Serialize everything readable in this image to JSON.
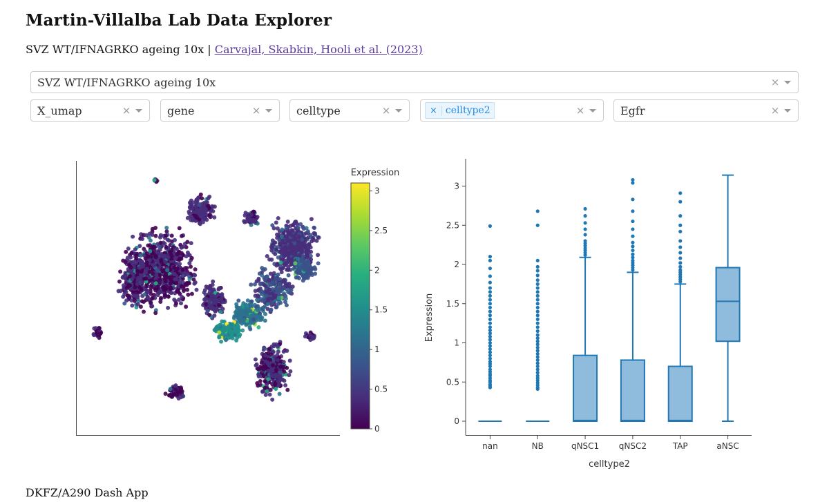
{
  "app": {
    "title": "Martin-Villalba Lab Data Explorer",
    "subtitle_prefix": "SVZ WT/IFNAGRKO ageing 10x | ",
    "subtitle_link": "Carvajal, Skabkin, Hooli et al. (2023)"
  },
  "controls": {
    "dataset": "SVZ WT/IFNAGRKO ageing 10x",
    "embedding": "X_umap",
    "color_by": "gene",
    "obs_field": "celltype",
    "selected_tag": "celltype2",
    "gene": "Egfr",
    "clear_glyph": "×",
    "tag_remove_glyph": "×"
  },
  "umap": {
    "colorbar_title": "Expression",
    "colorbar_ticks": [
      "0",
      "0.5",
      "1",
      "1.5",
      "2",
      "2.5",
      "3"
    ],
    "colorscale": [
      "#440154",
      "#472d7b",
      "#3b528b",
      "#2c728e",
      "#21918c",
      "#28ae80",
      "#5ec962",
      "#addc30",
      "#fde725"
    ]
  },
  "chart_data": {
    "type": "box",
    "xlabel": "celltype2",
    "ylabel": "Expression",
    "ylim": [
      0,
      3.2
    ],
    "yticks": [
      0,
      0.5,
      1,
      1.5,
      2,
      2.5,
      3
    ],
    "color": "#1f77b4",
    "fill": "#8fbbdc",
    "boxes": [
      {
        "category": "nan",
        "min": 0,
        "q1": 0,
        "median": 0,
        "q3": 0,
        "max": 0,
        "outliers": [
          0.43,
          0.45,
          0.47,
          0.5,
          0.52,
          0.55,
          0.58,
          0.6,
          0.63,
          0.66,
          0.7,
          0.73,
          0.76,
          0.8,
          0.84,
          0.88,
          0.92,
          0.96,
          1.0,
          1.04,
          1.08,
          1.12,
          1.16,
          1.2,
          1.25,
          1.3,
          1.35,
          1.4,
          1.45,
          1.5,
          1.55,
          1.6,
          1.65,
          1.7,
          1.77,
          1.85,
          1.95,
          2.05,
          2.1,
          2.49
        ]
      },
      {
        "category": "NB",
        "min": 0,
        "q1": 0,
        "median": 0,
        "q3": 0,
        "max": 0,
        "outliers": [
          0.41,
          0.43,
          0.46,
          0.49,
          0.52,
          0.55,
          0.58,
          0.62,
          0.66,
          0.7,
          0.74,
          0.78,
          0.82,
          0.86,
          0.9,
          0.94,
          0.98,
          1.02,
          1.06,
          1.1,
          1.15,
          1.2,
          1.25,
          1.3,
          1.35,
          1.4,
          1.45,
          1.5,
          1.55,
          1.6,
          1.65,
          1.7,
          1.75,
          1.8,
          1.86,
          1.92,
          1.97,
          2.05,
          2.5,
          2.68
        ]
      },
      {
        "category": "qNSC1",
        "min": 0,
        "q1": 0,
        "median": 0.01,
        "q3": 0.84,
        "max": 2.09,
        "outliers": [
          2.12,
          2.15,
          2.18,
          2.21,
          2.24,
          2.27,
          2.3,
          2.38,
          2.45,
          2.53,
          2.62,
          2.71
        ]
      },
      {
        "category": "qNSC2",
        "min": 0,
        "q1": 0,
        "median": 0.01,
        "q3": 0.78,
        "max": 1.9,
        "outliers": [
          1.93,
          1.96,
          1.99,
          2.02,
          2.05,
          2.09,
          2.13,
          2.18,
          2.23,
          2.28,
          2.36,
          2.45,
          2.55,
          2.68,
          2.83,
          3.04,
          3.08
        ]
      },
      {
        "category": "TAP",
        "min": 0,
        "q1": 0,
        "median": 0.01,
        "q3": 0.7,
        "max": 1.75,
        "outliers": [
          1.78,
          1.81,
          1.84,
          1.87,
          1.9,
          1.93,
          1.97,
          2.02,
          2.08,
          2.15,
          2.22,
          2.3,
          2.42,
          2.5,
          2.62,
          2.8,
          2.91
        ]
      },
      {
        "category": "aNSC",
        "min": 0,
        "q1": 1.02,
        "median": 1.53,
        "q3": 1.96,
        "max": 3.14,
        "outliers": []
      }
    ]
  },
  "footer": "DKFZ/A290 Dash App"
}
